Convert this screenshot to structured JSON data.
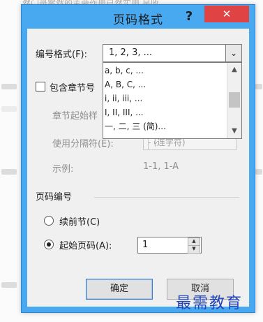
{
  "background": {
    "top_text": "然门录案然的主要作用已然实用 是收"
  },
  "dialog": {
    "title": "页码格式",
    "help_label": "?",
    "close_label": "✕",
    "number_format": {
      "label": "编号格式(F):",
      "value": "1, 2, 3, ..."
    },
    "dropdown": {
      "items": [
        "a, b, c, ...",
        "A, B, C, ...",
        "i, ii, iii, ...",
        "I, II, III, ...",
        "一, 二, 三 (简)..."
      ]
    },
    "include_chapter": {
      "label": "包含章节号"
    },
    "chapter_start": {
      "label": "章节起始样"
    },
    "separator": {
      "label": "使用分隔符(E):",
      "value": "- (连字符)"
    },
    "example": {
      "label": "示例:",
      "value": "1-1, 1-A"
    },
    "page_numbering": {
      "label": "页码编号",
      "continue": {
        "label": "续前节(C)"
      },
      "start_at": {
        "label": "起始页码(A):",
        "value": "1"
      }
    },
    "ok_label": "确定",
    "cancel_label": "取消"
  },
  "watermark": "最需教育"
}
